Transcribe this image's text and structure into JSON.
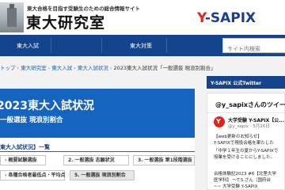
{
  "header": {
    "tagline": "東大合格を目指す受験生のための総合情報サイト",
    "site_title": "東大研究室",
    "partner_logo_text": "SAPIX"
  },
  "nav": {
    "items": [
      "東大入試",
      "東大対策"
    ],
    "search_placeholder": "サイト内検索"
  },
  "breadcrumb": {
    "items": [
      "トップ",
      "東大研究室",
      "東大入試",
      "東大入試状況",
      "2023東大入試状況「一般選抜 現浪別割合」"
    ]
  },
  "hero": {
    "title": "2023東大入試状況",
    "subtitle": "一般選抜 現浪別割合"
  },
  "list": {
    "heading": "東大入試状況】一覧",
    "pills": [
      "概要試験選抜",
      "2. 一般選抜 志願状況",
      "3. 一般選抜 第1段階選抜",
      "各種合格者最低点・平均点",
      "5. 一般選抜 現浪別割合"
    ]
  },
  "sidebar": {
    "header": "Y-SAPIX 公式Twitter",
    "twitter": {
      "title": "@y_sapixさんのツイート",
      "name": "大学受験 Y-SAPIX【公...",
      "meta": "@y_sapix · 5月26日",
      "lines": [
        "【web更新のお知らせ】",
        "Y-SAPIXで現役合格を果たした",
        "「中学１年生の夏からY-SAPIXで",
        "授業を受けることにしました。",
        "",
        "合格体験記2023 #6【北里大学",
        "医学科】 ～T.S.さん（国府台",
        "~~ 大学受験 Y-SAPIX"
      ]
    }
  },
  "colors": {
    "nav_bg": "#14448e",
    "hero_bg": "#1565c0",
    "sapix_red": "#e2231a",
    "sapix_blue": "#1b3f8f",
    "page_bg": "#f2f2f2"
  },
  "icons": [
    "logo-photo",
    "twitter-avatar"
  ]
}
